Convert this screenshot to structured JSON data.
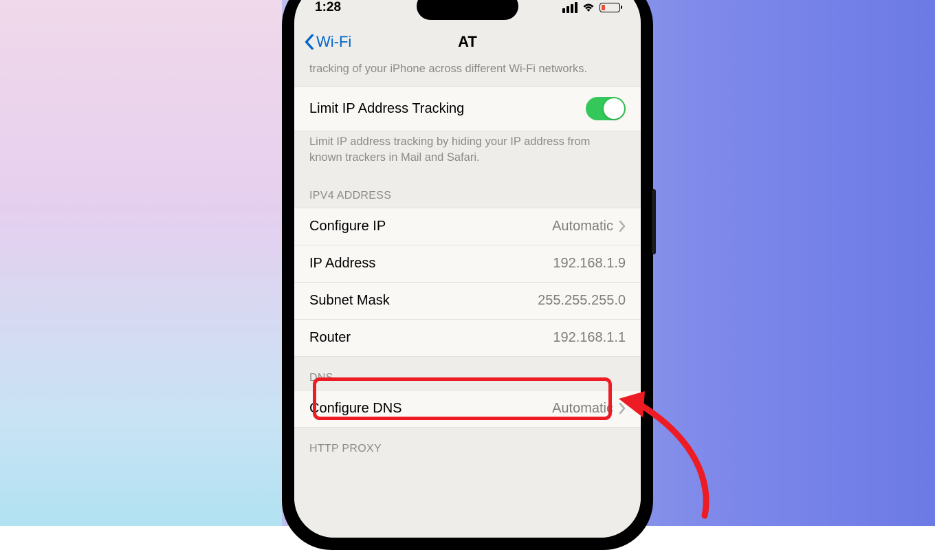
{
  "status": {
    "time": "1:28"
  },
  "nav": {
    "back_label": "Wi-Fi",
    "title": "AT"
  },
  "footer_private": "tracking of your iPhone across different Wi-Fi networks.",
  "limit_ip": {
    "label": "Limit IP Address Tracking",
    "footer": "Limit IP address tracking by hiding your IP address from known trackers in Mail and Safari."
  },
  "ipv4": {
    "header": "IPV4 ADDRESS",
    "configure_ip": {
      "label": "Configure IP",
      "value": "Automatic"
    },
    "ip_address": {
      "label": "IP Address",
      "value": "192.168.1.9"
    },
    "subnet_mask": {
      "label": "Subnet Mask",
      "value": "255.255.255.0"
    },
    "router": {
      "label": "Router",
      "value": "192.168.1.1"
    }
  },
  "dns": {
    "header": "DNS",
    "configure_dns": {
      "label": "Configure DNS",
      "value": "Automatic"
    }
  },
  "http_proxy": {
    "header": "HTTP PROXY"
  }
}
